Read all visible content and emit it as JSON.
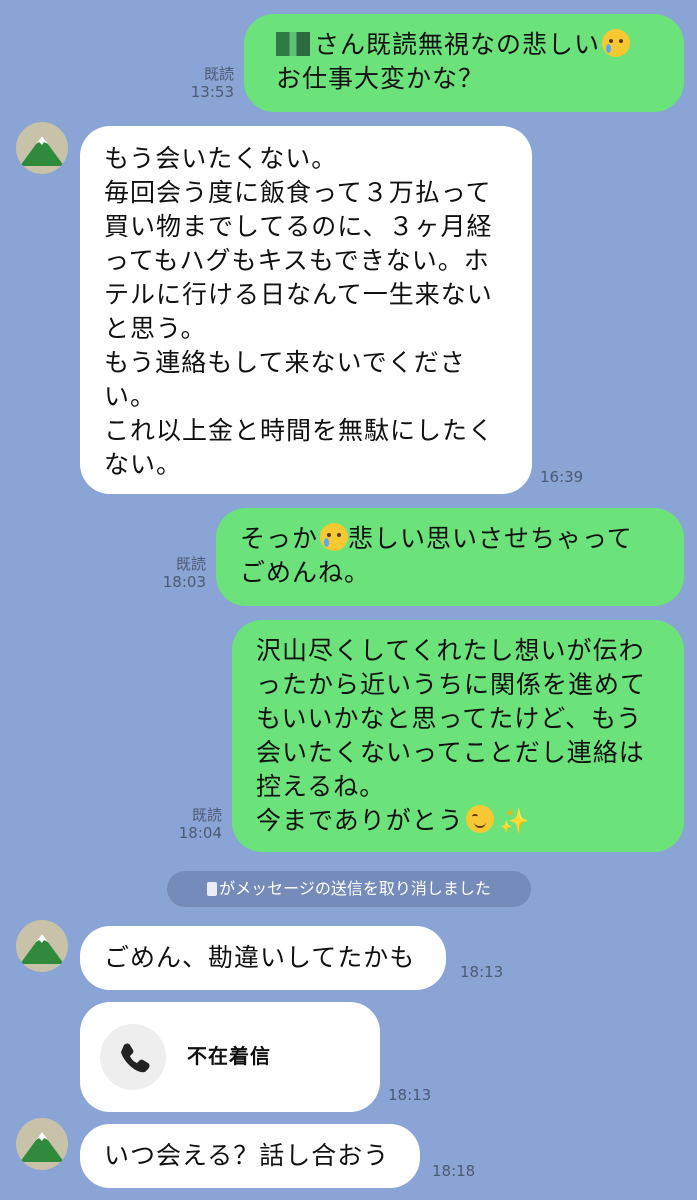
{
  "messages": {
    "m1": {
      "name_suffix": "さん既読無視なの悲しい",
      "line2": "お仕事大変かな？",
      "read": "既読",
      "time": "13:53"
    },
    "m2": {
      "lines": [
        "もう会いたくない。",
        "毎回会う度に飯食って３万払って",
        "買い物までしてるのに、３ヶ月経",
        "ってもハグもキスもできない。ホ",
        "テルに行ける日なんて一生来ない",
        "と思う。",
        "もう連絡もして来ないでくださ",
        "い。",
        "これ以上金と時間を無駄にしたく",
        "ない。"
      ],
      "time": "16:39"
    },
    "m3": {
      "line1a": "そっか",
      "line1b": "悲しい思いさせちゃって",
      "line2": "ごめんね。",
      "read": "既読",
      "time": "18:03"
    },
    "m4": {
      "lines": [
        "沢山尽くしてくれたし想いが伝わ",
        "ったから近いうちに関係を進めて",
        "もいいかなと思ってたけど、もう",
        "会いたくないってことだし連絡は",
        "控えるね。"
      ],
      "last": "今までありがとう",
      "read": "既読",
      "time": "18:04"
    },
    "system": {
      "text": "がメッセージの送信を取り消しました"
    },
    "m5": {
      "text": "ごめん、勘違いしてたかも",
      "time": "18:13"
    },
    "m6": {
      "label": "不在着信",
      "time": "18:13"
    },
    "m7": {
      "text": "いつ会える？話し合おう",
      "time": "18:18"
    }
  },
  "colors": {
    "background": "#8aa4d6",
    "sent_bubble": "#6be27a",
    "received_bubble": "#ffffff"
  },
  "icons": [
    "avatar-mountain-icon",
    "crying-face-icon",
    "smiling-face-icon",
    "sparkles-icon",
    "phone-icon"
  ]
}
